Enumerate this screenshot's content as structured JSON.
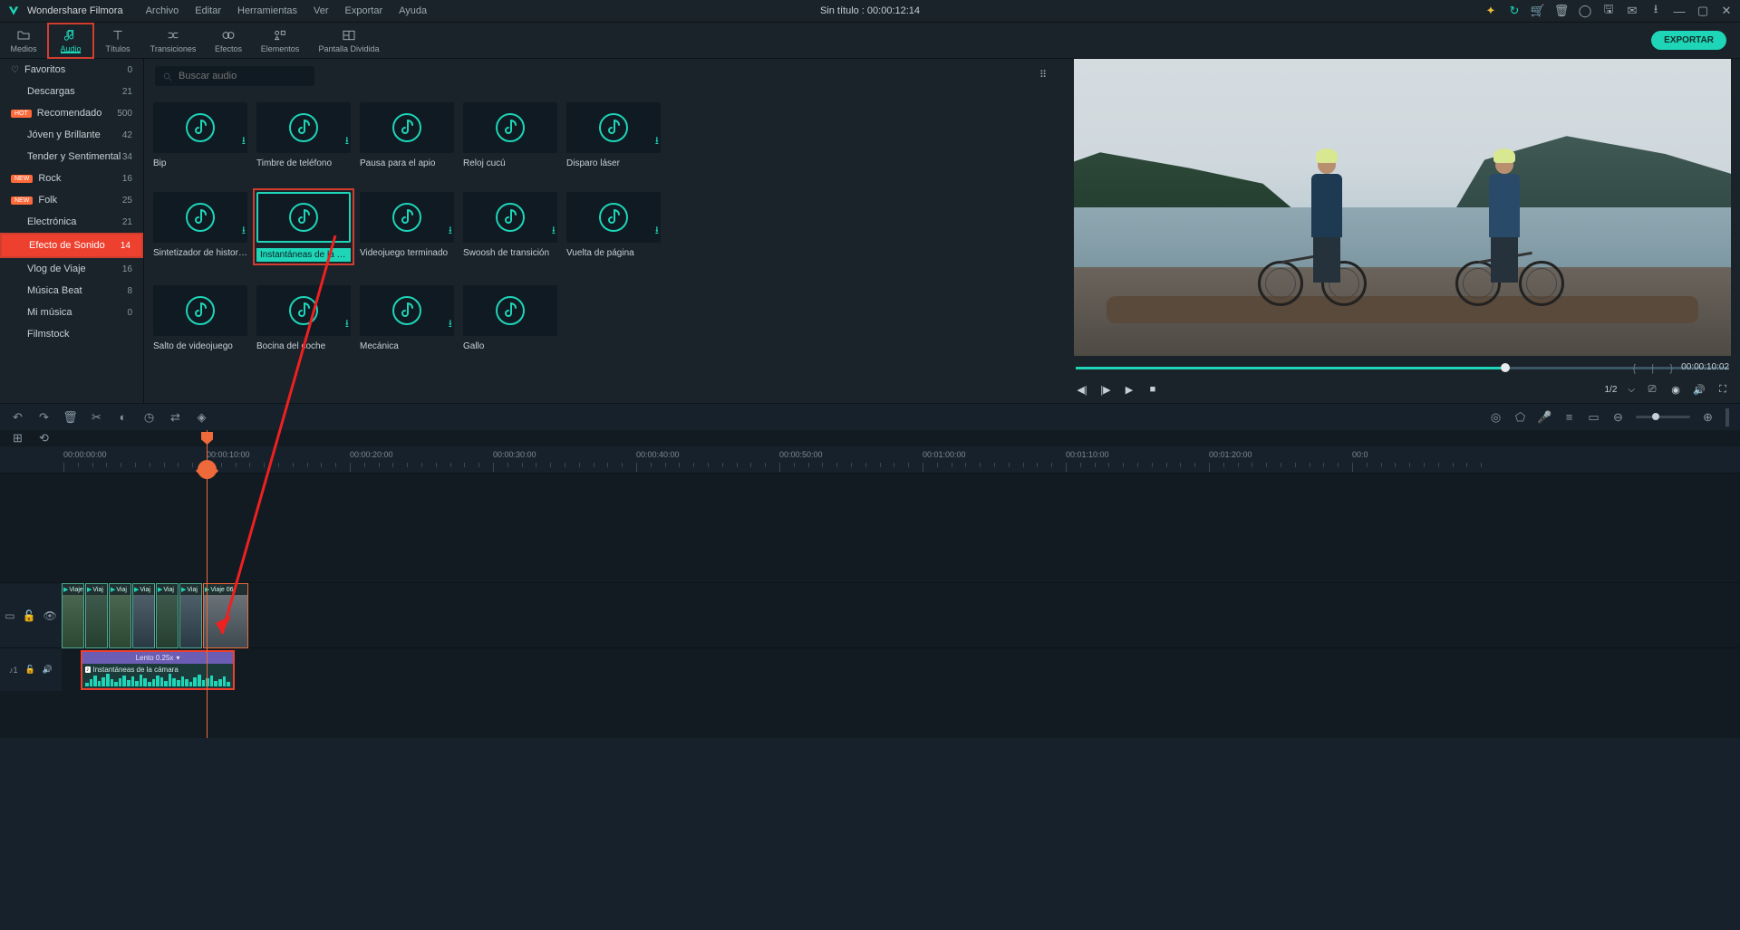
{
  "app_name": "Wondershare Filmora",
  "project_title": "Sin título : 00:00:12:14",
  "menu": [
    "Archivo",
    "Editar",
    "Herramientas",
    "Ver",
    "Exportar",
    "Ayuda"
  ],
  "tabs": [
    {
      "label": "Medios",
      "icon": "folder"
    },
    {
      "label": "Audio",
      "icon": "music"
    },
    {
      "label": "Títulos",
      "icon": "text"
    },
    {
      "label": "Transiciones",
      "icon": "transition"
    },
    {
      "label": "Efectos",
      "icon": "fx"
    },
    {
      "label": "Elementos",
      "icon": "elements"
    },
    {
      "label": "Pantalla Dividida",
      "icon": "split"
    }
  ],
  "export_label": "EXPORTAR",
  "search_placeholder": "Buscar audio",
  "sidebar": [
    {
      "label": "Favoritos",
      "count": "0",
      "icon": "heart"
    },
    {
      "label": "Descargas",
      "count": "21"
    },
    {
      "label": "Recomendado",
      "count": "500",
      "badge": "HOT"
    },
    {
      "label": "Jóven y Brillante",
      "count": "42"
    },
    {
      "label": "Tender y Sentimental",
      "count": "34"
    },
    {
      "label": "Rock",
      "count": "16",
      "badge": "New"
    },
    {
      "label": "Folk",
      "count": "25",
      "badge": "New"
    },
    {
      "label": "Electrónica",
      "count": "21"
    },
    {
      "label": "Efecto de Sonido",
      "count": "14",
      "selected": true
    },
    {
      "label": "Vlog de Viaje",
      "count": "16"
    },
    {
      "label": "Música Beat",
      "count": "8"
    },
    {
      "label": "Mi música",
      "count": "0"
    },
    {
      "label": "Filmstock",
      "count": ""
    }
  ],
  "audio_items": [
    {
      "label": "Bip",
      "dl": true
    },
    {
      "label": "Timbre de teléfono",
      "dl": true
    },
    {
      "label": "Pausa para el apio",
      "dl": false
    },
    {
      "label": "Reloj cucú",
      "dl": false
    },
    {
      "label": "Disparo láser",
      "dl": true
    },
    {
      "label": "Sintetizador de histor…",
      "dl": true
    },
    {
      "label": "Instantáneas de la cá…",
      "selected": true
    },
    {
      "label": "Videojuego terminado",
      "dl": true
    },
    {
      "label": "Swoosh de transición",
      "dl": true
    },
    {
      "label": "Vuelta de página",
      "dl": true
    },
    {
      "label": "Salto de videojuego",
      "dl": false
    },
    {
      "label": "Bocina del coche",
      "dl": true
    },
    {
      "label": "Mecánica",
      "dl": true
    },
    {
      "label": "Gallo",
      "dl": false
    }
  ],
  "preview": {
    "time": "00:00:10:02",
    "ratio": "1/2"
  },
  "timeline": {
    "ruler": [
      "00:00:00:00",
      "00:00:10:00",
      "00:00:20:00",
      "00:00:30:00",
      "00:00:40:00",
      "00:00:50:00",
      "00:01:00:00",
      "00:01:10:00",
      "00:01:20:00",
      "00:0"
    ],
    "playhead_time": "00:00:10:00",
    "clips": [
      {
        "label": "Viaje"
      },
      {
        "label": "Viaj"
      },
      {
        "label": "Viaj"
      },
      {
        "label": "Viaj"
      },
      {
        "label": "Viaj"
      },
      {
        "label": "Viaj"
      },
      {
        "label": "Viaje 06",
        "wide": true
      }
    ],
    "audio_speed_label": "Lento 0.25x",
    "audio_clip_label": "Instantáneas de la cámara"
  }
}
